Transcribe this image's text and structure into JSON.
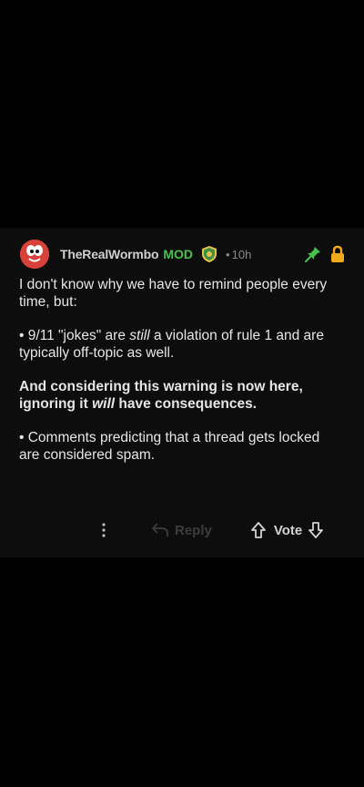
{
  "comment": {
    "author": "TheRealWormbo",
    "mod_tag": "MOD",
    "separator": "•",
    "time": "10h",
    "paragraph1": "I don't know why we have to remind people every time, but:",
    "p2_prefix": "• 9/11 \"jokes\" are ",
    "p2_emph": "still",
    "p2_suffix": " a violation of rule 1 and are typically off-topic as well.",
    "p3_prefix": "And considering this warning is now here, ignoring it ",
    "p3_emph": "will",
    "p3_suffix": " have consequences.",
    "paragraph4": "• Comments predicting that a thread gets locked are considered spam."
  },
  "actions": {
    "reply_label": "Reply",
    "vote_label": "Vote"
  },
  "icons": {
    "avatar": "avatar",
    "moderator_shield": "shield-icon",
    "pinned": "pin-icon",
    "locked": "lock-icon",
    "more": "more-icon",
    "reply": "reply-icon",
    "upvote": "upvote-icon",
    "downvote": "downvote-icon"
  },
  "colors": {
    "background": "#000000",
    "card": "#0d0d0d",
    "mod_green": "#46c14b",
    "pin_green": "#46c14b",
    "lock_gold": "#f2a91a",
    "text": "#e6e6e6",
    "muted": "#8a8a8a"
  }
}
